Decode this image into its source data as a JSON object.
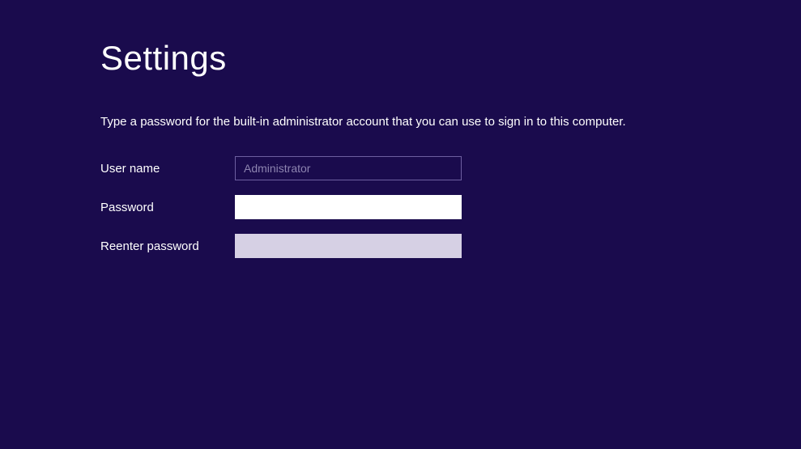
{
  "page": {
    "title": "Settings",
    "instruction": "Type a password for the built-in administrator account that you can use to sign in to this computer."
  },
  "form": {
    "username": {
      "label": "User name",
      "value": "Administrator"
    },
    "password": {
      "label": "Password",
      "value": ""
    },
    "reenter_password": {
      "label": "Reenter password",
      "value": ""
    }
  }
}
